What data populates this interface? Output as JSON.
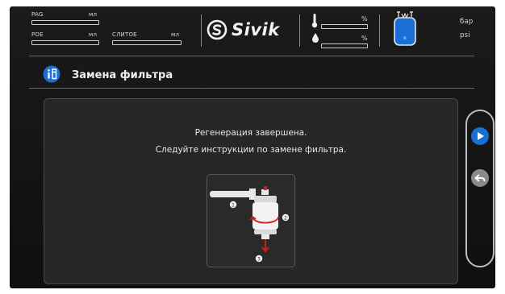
{
  "header": {
    "pag_label": "PAG",
    "pag_unit": "мл",
    "poe_label": "POE",
    "poe_unit": "мл",
    "drain_label": "СЛИТОЕ",
    "drain_unit": "мл",
    "logo_text": "Sivik",
    "pct_top": "%",
    "pct_bottom": "%",
    "tank_label": "R",
    "unit_bar": "бар",
    "unit_psi": "psi"
  },
  "page": {
    "title": "Замена фильтра"
  },
  "main": {
    "line1": "Регенерация  завершена.",
    "line2": "Следуйте инструкции по замене фильтра."
  },
  "illustration": {
    "step1": "1",
    "step2": "2",
    "step3": "3"
  },
  "colors": {
    "accent_blue": "#1a6fd6",
    "arrow_red": "#d11a1a"
  },
  "icons": {
    "info": "info-icon",
    "next": "play-icon",
    "back": "back-arrow-icon"
  }
}
